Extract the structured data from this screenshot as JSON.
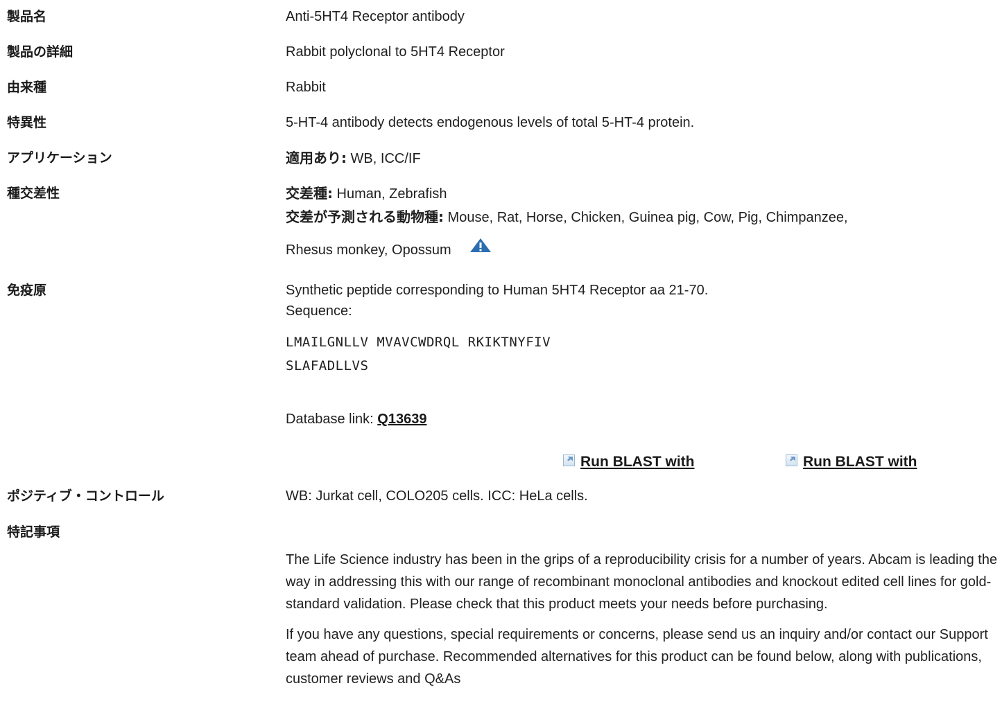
{
  "rows": {
    "name": {
      "label": "製品名",
      "value": "Anti-5HT4 Receptor antibody"
    },
    "detail": {
      "label": "製品の詳細",
      "value": "Rabbit polyclonal to 5HT4 Receptor"
    },
    "host": {
      "label": "由来種",
      "value": "Rabbit"
    },
    "specificity": {
      "label": "特異性",
      "value": "5-HT-4 antibody detects endogenous levels of total 5-HT-4 protein."
    },
    "applications": {
      "label": "アプリケーション",
      "prefix": "適用あり:",
      "value": " WB, ICC/IF"
    },
    "reactivity": {
      "label": "種交差性",
      "line1_prefix": "交差種:",
      "line1_value": " Human, Zebrafish",
      "line2_prefix": "交差が予測される動物種:",
      "line2_value": " Mouse, Rat, Horse, Chicken, Guinea pig, Cow, Pig, Chimpanzee,",
      "line3_value": "Rhesus monkey, Opossum",
      "warning_icon": "warning-triangle-icon"
    },
    "immunogen": {
      "label": "免疫原",
      "line1": "Synthetic peptide corresponding to Human 5HT4 Receptor aa 21-70.",
      "line2": "Sequence:",
      "seq1": "LMAILGNLLV MVAVCWDRQL RKIKTNYFIV",
      "seq2": "SLAFADLLVS",
      "db_prefix": "Database link: ",
      "db_link": "Q13639",
      "blast1": "Run BLAST with",
      "blast2": "Run BLAST with"
    },
    "positive": {
      "label": "ポジティブ・コントロール",
      "value": "WB: Jurkat cell, COLO205 cells. ICC: HeLa cells."
    },
    "notes": {
      "label": "特記事項",
      "para1": "The Life Science industry has been in the grips of a reproducibility crisis for a number of years. Abcam is leading the way in addressing this with our range of recombinant monoclonal antibodies and knockout edited cell lines for gold-standard validation. Please check that this product meets your needs before purchasing.",
      "para2": "If you have any questions, special requirements or concerns, please send us an inquiry and/or contact our Support team ahead of purchase. Recommended alternatives for this product can be found below, along with publications, customer reviews and Q&As"
    }
  },
  "colors": {
    "accent": "#2a6eb0",
    "text": "#222222"
  }
}
